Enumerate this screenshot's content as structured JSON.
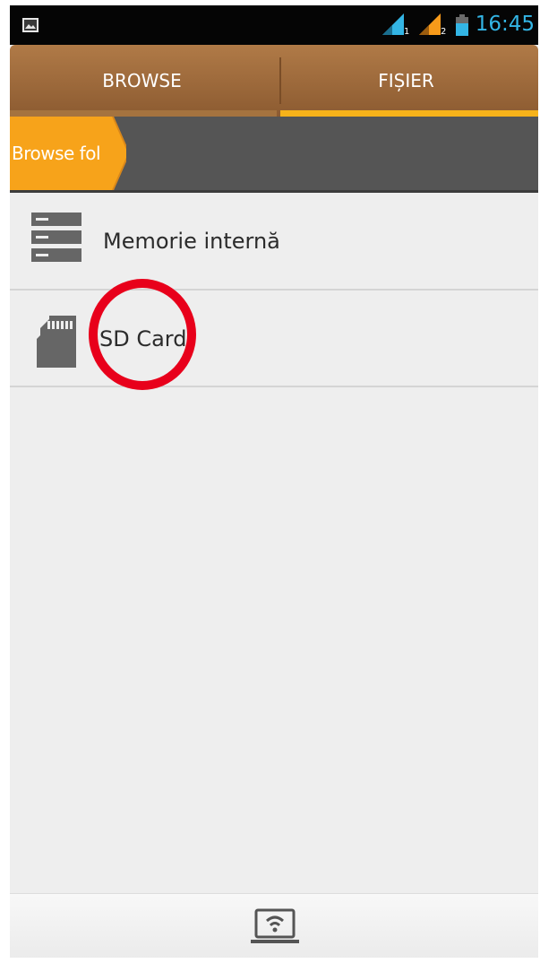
{
  "status_bar": {
    "time": "16:45",
    "icons": [
      "image-notification-icon",
      "signal-sim1-icon",
      "signal-sim2-icon",
      "battery-icon"
    ],
    "time_color": "#33b5e5"
  },
  "tabs": [
    {
      "label": "BROWSE",
      "selected": false
    },
    {
      "label": "FIȘIER",
      "selected": true
    }
  ],
  "breadcrumb": {
    "current": "Browse fol"
  },
  "storage_list": [
    {
      "label": "Memorie internă",
      "icon": "internal-storage-icon"
    },
    {
      "label": "SD Card",
      "icon": "sd-card-icon"
    }
  ],
  "annotation": {
    "type": "highlight-circle",
    "target": "SD Card",
    "color": "#e8001b"
  },
  "bottom_bar": {
    "icon": "wifi-display-icon"
  },
  "colors": {
    "tab_bar": "#9a6a3c",
    "tab_indicator": "#f7b31a",
    "breadcrumb_bg": "#555555",
    "breadcrumb_active": "#f7a31a",
    "list_bg": "#eeeeee"
  }
}
